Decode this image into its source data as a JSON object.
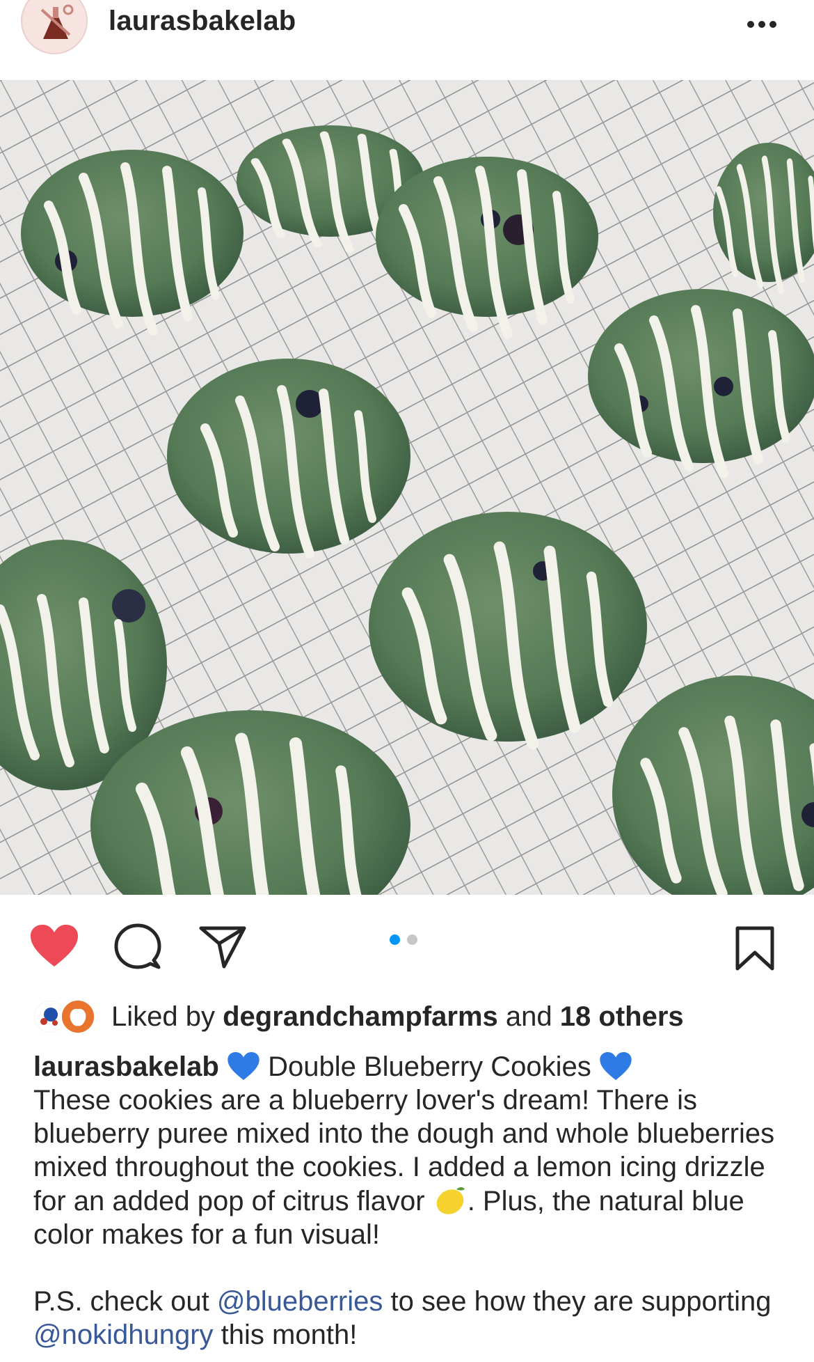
{
  "post": {
    "username": "laurasbakelab",
    "more_icon": "more-horizontal-icon"
  },
  "actions": {
    "like_icon": "heart-filled-icon",
    "like_color": "#ed4956",
    "comment_icon": "comment-icon",
    "share_icon": "send-icon",
    "save_icon": "bookmark-icon",
    "carousel": {
      "count": 2,
      "active": 1,
      "active_color": "#0095f6"
    }
  },
  "likes": {
    "prefix": "Liked by",
    "user": "degrandchampfarms",
    "middle": "and",
    "others": "18 others"
  },
  "caption": {
    "username": "laurasbakelab",
    "title": "Double Blueberry Cookies",
    "body": "These cookies are a blueberry lover's dream! There is blueberry puree mixed into the dough and whole blueberries mixed throughout the cookies. I added a lemon icing drizzle for an added pop of citrus flavor",
    "body_end": ". Plus, the natural blue color makes for a fun visual!",
    "ps_prefix": "P.S. check out",
    "mention1": "@blueberries",
    "ps_middle": "to see how they are supporting",
    "mention2": "@nokidhungry",
    "ps_end": "this month!"
  }
}
